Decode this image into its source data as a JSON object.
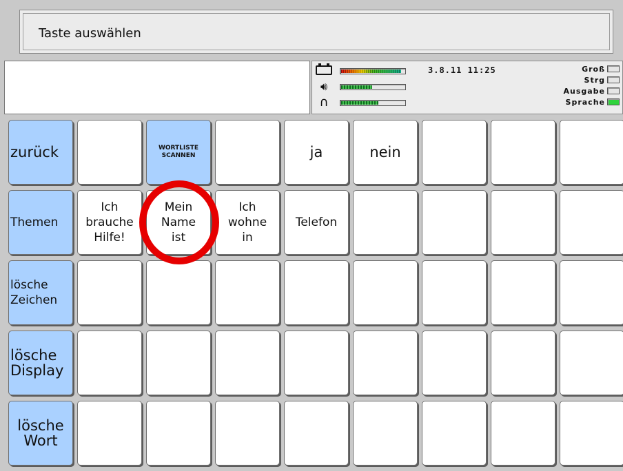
{
  "title": {
    "text": "Taste auswählen"
  },
  "display": {
    "text": ""
  },
  "status": {
    "battery_level": 0.95,
    "volume_level": 0.5,
    "headphone_level": 0.6,
    "datetime": "3.8.11 11:25",
    "indicators": [
      {
        "label": "Groß",
        "on": false
      },
      {
        "label": "Strg",
        "on": false
      },
      {
        "label": "Ausgabe",
        "on": false
      },
      {
        "label": "Sprache",
        "on": true
      }
    ],
    "icons": [
      "battery-icon",
      "speaker-icon",
      "headphones-icon"
    ]
  },
  "colors": {
    "nav_key": "#aad1ff",
    "key": "#ffffff",
    "highlight": "#e60000",
    "indicator_on": "#2fd33c"
  },
  "keys": {
    "r1": [
      "zurück",
      "",
      "WORTLISTE\nSCANNEN",
      "",
      "ja",
      "nein",
      "",
      "",
      ""
    ],
    "r2": [
      "Themen",
      "Ich\nbrauche\nHilfe!",
      "Mein\nName\nist",
      "Ich\nwohne\nin",
      "Telefon",
      "",
      "",
      "",
      ""
    ],
    "r3": [
      "lösche\nZeichen",
      "",
      "",
      "",
      "",
      "",
      "",
      "",
      ""
    ],
    "r4": [
      "lösche\nDisplay",
      "",
      "",
      "",
      "",
      "",
      "",
      "",
      ""
    ],
    "r5": [
      "lösche\nWort",
      "",
      "",
      "",
      "",
      "",
      "",
      "",
      ""
    ]
  }
}
